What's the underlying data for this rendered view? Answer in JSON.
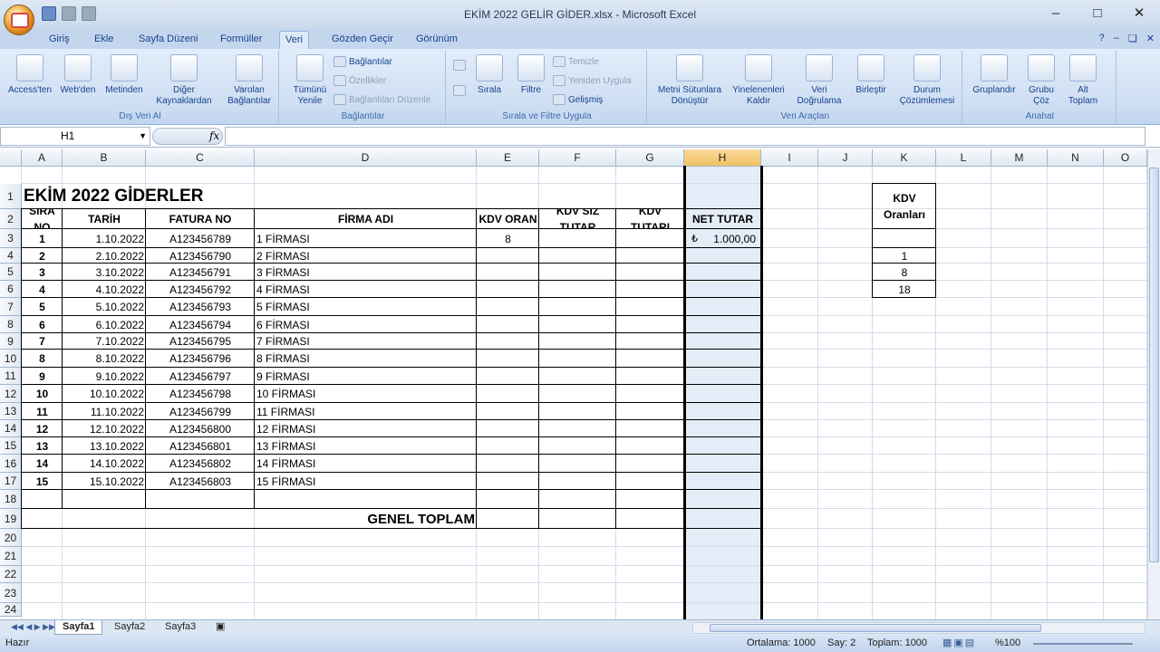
{
  "window": {
    "title": "EKİM 2022 GELİR GİDER.xlsx - Microsoft Excel"
  },
  "tabs": [
    "Giriş",
    "Ekle",
    "Sayfa Düzeni",
    "Formüller",
    "Veri",
    "Gözden Geçir",
    "Görünüm"
  ],
  "active_tab": "Veri",
  "ribbon": {
    "dis_veri": {
      "label": "Dış Veri Al",
      "buttons": [
        "Access'ten",
        "Web'den",
        "Metinden",
        "Diğer Kaynaklardan",
        "Varolan Bağlantılar"
      ]
    },
    "baglantilar": {
      "label": "Bağlantılar",
      "main": "Tümünü Yenile",
      "items": [
        "Bağlantılar",
        "Özellikler",
        "Bağlantıları Düzenle"
      ]
    },
    "sirala": {
      "label": "Sırala ve Filtre Uygula",
      "sirala": "Sırala",
      "filtre": "Filtre",
      "items": [
        "Temizle",
        "Yeniden Uygula",
        "Gelişmiş"
      ]
    },
    "veri_araclari": {
      "label": "Veri Araçları",
      "buttons": [
        "Metni Sütunlara Dönüştür",
        "Yinelenenleri Kaldır",
        "Veri Doğrulama",
        "Birleştir",
        "Durum Çözümlemesi"
      ]
    },
    "anahat": {
      "label": "Anahat",
      "buttons": [
        "Gruplandır",
        "Grubu Çöz",
        "Alt Toplam"
      ]
    }
  },
  "formula_bar": {
    "name_box": "H1",
    "fx": "fx",
    "formula": ""
  },
  "columns": [
    "A",
    "B",
    "C",
    "D",
    "E",
    "F",
    "G",
    "H",
    "I",
    "J",
    "K",
    "L",
    "M",
    "N",
    "O"
  ],
  "rows": [
    "1",
    "2",
    "3",
    "4",
    "5",
    "6",
    "7",
    "8",
    "9",
    "10",
    "11",
    "12",
    "13",
    "14",
    "15",
    "16",
    "17",
    "18",
    "19",
    "20",
    "21",
    "22",
    "23",
    "24"
  ],
  "sheet": {
    "title": "EKİM 2022 GİDERLER",
    "headers": {
      "sira": "SIRA NO",
      "tarih": "TARİH",
      "fatura": "FATURA NO",
      "firma": "FİRMA ADI",
      "kdv_oran": "KDV ORAN",
      "kdv_siz": "KDV SİZ TUTAR",
      "kdv_tutari": "KDV TUTARI",
      "net": "NET TUTAR"
    },
    "data_rows": [
      {
        "no": "1",
        "tarih": "1.10.2022",
        "fatura": "A123456789",
        "firma": "1 FİRMASI",
        "kdv": "8",
        "net_symbol": "₺",
        "net": "1.000,00"
      },
      {
        "no": "2",
        "tarih": "2.10.2022",
        "fatura": "A123456790",
        "firma": "2 FİRMASI"
      },
      {
        "no": "3",
        "tarih": "3.10.2022",
        "fatura": "A123456791",
        "firma": "3 FİRMASI"
      },
      {
        "no": "4",
        "tarih": "4.10.2022",
        "fatura": "A123456792",
        "firma": "4 FİRMASI"
      },
      {
        "no": "5",
        "tarih": "5.10.2022",
        "fatura": "A123456793",
        "firma": "5 FİRMASI"
      },
      {
        "no": "6",
        "tarih": "6.10.2022",
        "fatura": "A123456794",
        "firma": "6 FİRMASI"
      },
      {
        "no": "7",
        "tarih": "7.10.2022",
        "fatura": "A123456795",
        "firma": "7 FİRMASI"
      },
      {
        "no": "8",
        "tarih": "8.10.2022",
        "fatura": "A123456796",
        "firma": "8 FİRMASI"
      },
      {
        "no": "9",
        "tarih": "9.10.2022",
        "fatura": "A123456797",
        "firma": "9 FİRMASI"
      },
      {
        "no": "10",
        "tarih": "10.10.2022",
        "fatura": "A123456798",
        "firma": "10 FİRMASI"
      },
      {
        "no": "11",
        "tarih": "11.10.2022",
        "fatura": "A123456799",
        "firma": "11 FİRMASI"
      },
      {
        "no": "12",
        "tarih": "12.10.2022",
        "fatura": "A123456800",
        "firma": "12 FİRMASI"
      },
      {
        "no": "13",
        "tarih": "13.10.2022",
        "fatura": "A123456801",
        "firma": "13 FİRMASI"
      },
      {
        "no": "14",
        "tarih": "14.10.2022",
        "fatura": "A123456802",
        "firma": "14 FİRMASI"
      },
      {
        "no": "15",
        "tarih": "15.10.2022",
        "fatura": "A123456803",
        "firma": "15 FİRMASI"
      }
    ],
    "genel_toplam": "GENEL TOPLAM",
    "kdv_oranlari": {
      "header": "KDV Oranları",
      "values": [
        "",
        "1",
        "8",
        "18"
      ]
    }
  },
  "sheet_tabs": [
    "Sayfa1",
    "Sayfa2",
    "Sayfa3"
  ],
  "active_sheet": "Sayfa1",
  "status": {
    "mode": "Hazır",
    "ortalama": "Ortalama: 1000",
    "say": "Say: 2",
    "toplam": "Toplam: 1000",
    "zoom": "%100"
  }
}
